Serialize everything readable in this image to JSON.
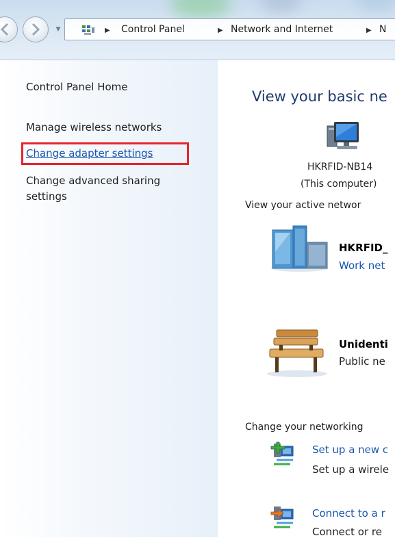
{
  "breadcrumb": {
    "items": [
      "Control Panel",
      "Network and Internet",
      "N"
    ]
  },
  "left_pane": {
    "home": "Control Panel Home",
    "links": [
      "Manage wireless networks",
      "Change adapter settings",
      "Change advanced sharing",
      "settings"
    ]
  },
  "main": {
    "title": "View your basic ne",
    "computer": {
      "name": "HKRFID-NB14",
      "note": "(This computer)"
    },
    "active_label": "View your active networ",
    "networks": [
      {
        "name": "HKRFID_",
        "type": "Work net"
      },
      {
        "name": "Unidenti",
        "type": "Public ne"
      }
    ],
    "change_label": "Change your networking",
    "tasks": [
      {
        "title": "Set up a new c",
        "desc": "Set up a wirele"
      },
      {
        "title": "Connect to a r",
        "desc": "Connect or re"
      }
    ]
  },
  "icons": {
    "control_panel": "control-panel-icon",
    "computer": "computer-icon",
    "work_network": "work-network-icon",
    "public_network": "bench-icon",
    "setup_task": "network-setup-icon",
    "connect_task": "network-connect-icon"
  },
  "colors": {
    "link": "#1a56ae",
    "highlight": "#e8222d",
    "title": "#1e3a6e"
  }
}
